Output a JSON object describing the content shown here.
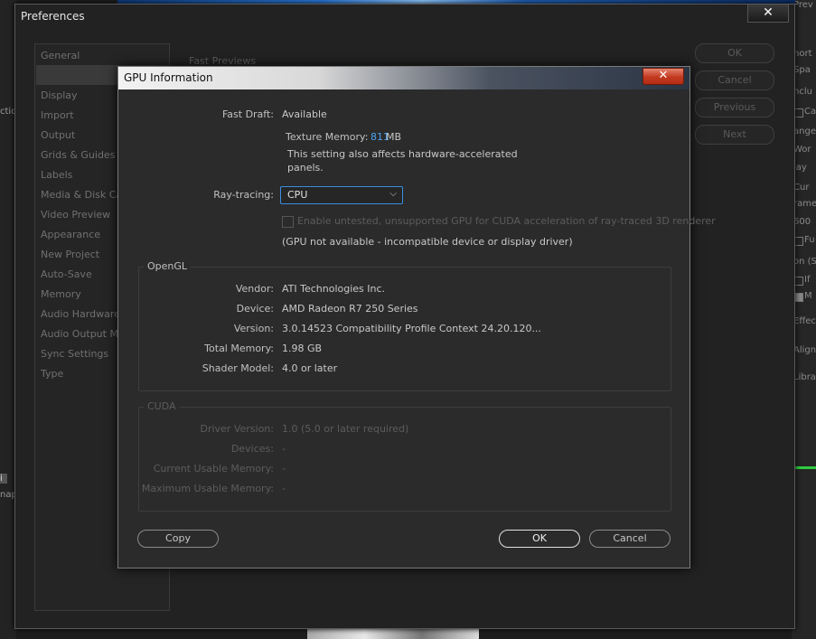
{
  "background": {
    "left_fragments": [
      "ctio",
      "i",
      "nap"
    ],
    "right_fragments": [
      "Prev",
      "hort",
      "Spa",
      "nclu",
      "Ca",
      "ange",
      "Wor",
      "lay",
      "Cur",
      "rame",
      "600",
      "Fu",
      "on (S",
      "If",
      "M",
      "Effec",
      "Align",
      "Libra"
    ]
  },
  "preferences": {
    "title": "Preferences",
    "close": "✕",
    "section_title": "Fast Previews",
    "categories": [
      "General",
      "",
      "Display",
      "Import",
      "Output",
      "Grids & Guides",
      "Labels",
      "Media & Disk Ca",
      "Video Preview",
      "Appearance",
      "New Project",
      "Auto-Save",
      "Memory",
      "Audio Hardware",
      "Audio Output Ma",
      "Sync Settings",
      "Type"
    ],
    "buttons": {
      "ok": "OK",
      "cancel": "Cancel",
      "previous": "Previous",
      "next": "Next"
    }
  },
  "gpu_dialog": {
    "title": "GPU Information",
    "close": "✕",
    "fast_draft": {
      "label": "Fast Draft:",
      "value": "Available"
    },
    "texture_memory": {
      "label": "Texture Memory:",
      "value": "811",
      "unit": "MB"
    },
    "note_line1": "This setting also affects hardware-accelerated",
    "note_line2": "panels.",
    "ray_tracing": {
      "label": "Ray-tracing:",
      "value": "CPU",
      "chevron": "⌵"
    },
    "cuda_checkbox_label": "Enable untested, unsupported GPU for CUDA acceleration of ray-traced 3D renderer",
    "gpu_unavailable": "(GPU not available - incompatible device or display driver)",
    "opengl": {
      "title": "OpenGL",
      "rows": [
        {
          "label": "Vendor:",
          "value": "ATI Technologies Inc."
        },
        {
          "label": "Device:",
          "value": "AMD Radeon R7 250 Series"
        },
        {
          "label": "Version:",
          "value": "3.0.14523 Compatibility Profile Context 24.20.120..."
        },
        {
          "label": "Total Memory:",
          "value": "1.98 GB"
        },
        {
          "label": "Shader Model:",
          "value": "4.0 or later"
        }
      ]
    },
    "cuda": {
      "title": "CUDA",
      "rows": [
        {
          "label": "Driver Version:",
          "value": "1.0 (5.0 or later required)"
        },
        {
          "label": "Devices:",
          "value": "-"
        },
        {
          "label": "Current Usable Memory:",
          "value": "-"
        },
        {
          "label": "Maximum Usable Memory:",
          "value": "-"
        }
      ]
    },
    "buttons": {
      "copy": "Copy",
      "ok": "OK",
      "cancel": "Cancel"
    }
  }
}
